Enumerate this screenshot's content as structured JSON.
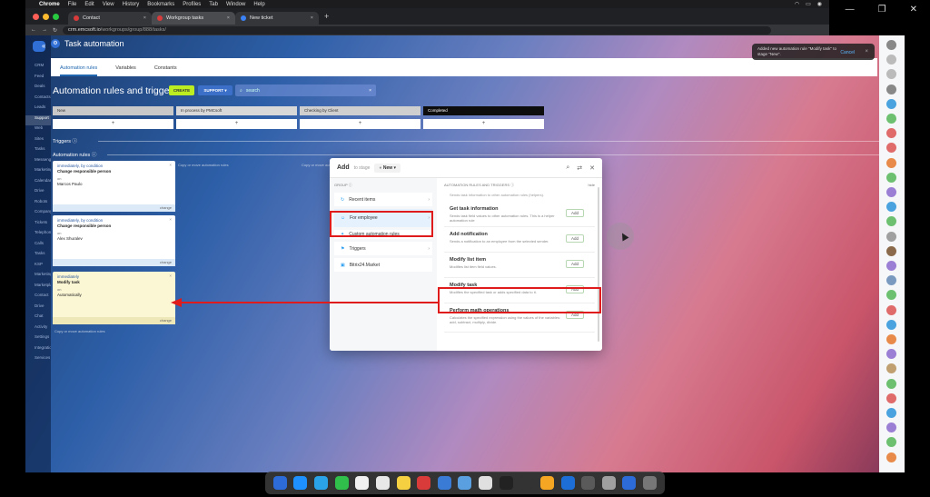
{
  "menubar": {
    "items": [
      "Chrome",
      "File",
      "Edit",
      "View",
      "History",
      "Bookmarks",
      "Profiles",
      "Tab",
      "Window",
      "Help"
    ]
  },
  "browser": {
    "tabs": [
      {
        "label": "Contact"
      },
      {
        "label": "Workgroup tasks"
      },
      {
        "label": "New ticket"
      }
    ],
    "url_host": "crm.emcsoft.io",
    "url_path": "/workgroups/group/888/tasks/"
  },
  "nav": {
    "items": [
      "CRM",
      "Feed",
      "Deals",
      "Contacts",
      "Leads",
      "Support",
      "Web",
      "Sites",
      "Tasks",
      "Messenger",
      "Marketing",
      "Calendar",
      "Drive",
      "Robots",
      "Company",
      "Tickets",
      "Telephony",
      "Calls",
      "Tasks",
      "KSP",
      "Marketing",
      "Marketplace",
      "Contact",
      "Drive",
      "Chat",
      "Activity",
      "Settings",
      "Integrations",
      "Services"
    ]
  },
  "header": {
    "title": "Task automation",
    "tabs": [
      "Automation rules",
      "Variables",
      "Constants"
    ]
  },
  "toolbar": {
    "title": "Automation rules and triggers",
    "create": "CREATE",
    "support": "SUPPORT",
    "search_placeholder": "search"
  },
  "stages": [
    {
      "label": "New",
      "color": "#c8c8c8"
    },
    {
      "label": "In process by PMCsoft",
      "color": "#d8d8d8"
    },
    {
      "label": "Checking by Client",
      "color": "#cfcfcf"
    },
    {
      "label": "Completed",
      "color": "#0d0d0d"
    }
  ],
  "plus": "+",
  "sections": {
    "triggers": "Triggers",
    "automation_rules": "Automation rules"
  },
  "rules": [
    {
      "head": "immediately, by condition",
      "title": "Change responsible person",
      "sub": "on",
      "who": "Marcos Paulo",
      "foot": "change"
    },
    {
      "head": "immediately, by condition",
      "title": "Change responsible person",
      "sub": "on",
      "who": "Alex Shuralev",
      "foot": "change"
    },
    {
      "head": "immediately",
      "title": "Modify task",
      "sub": "on",
      "who": "Automatically",
      "foot": "change"
    }
  ],
  "hints": {
    "copy1": "Copy or move automation rules",
    "copy2": "Copy or move automation rules",
    "copy3": "Copy or move automation rules"
  },
  "modal": {
    "title": "Add",
    "to_stage": "to stage",
    "stage": "New",
    "group_label": "GROUP",
    "groups": [
      {
        "label": "Recent items",
        "icon": "↻"
      },
      {
        "label": "For employee",
        "icon": "☺"
      },
      {
        "label": "Custom automation rules",
        "icon": "✦"
      },
      {
        "label": "Triggers",
        "icon": "⚑"
      },
      {
        "label": "Bitrix24.Market",
        "icon": "▣"
      }
    ],
    "right_label": "AUTOMATION RULES AND TRIGGERS",
    "hide": "hide",
    "top_desc": "Sends task information to other automation rules (helpers).",
    "items": [
      {
        "title": "Get task information",
        "desc": "Sends task field values to other automation rules. This is a helper automation rule",
        "btn": "Add"
      },
      {
        "title": "Add notification",
        "desc": "Sends a notification to an employee from the selected sender.",
        "btn": "Add"
      },
      {
        "title": "Modify list item",
        "desc": "Modifies list item field values.",
        "btn": "Add"
      },
      {
        "title": "Modify task",
        "desc": "Modifies the specified task or adds specified data to it.",
        "btn": "Add"
      },
      {
        "title": "Perform math operations",
        "desc": "Calculates the specified expression using the values of the variables: add, subtract, multiply, divide.",
        "btn": "Add"
      }
    ]
  },
  "notification": {
    "text": "Added new automation rule \"Modify task\" to stage \"New\".",
    "cancel": "Cancel"
  }
}
